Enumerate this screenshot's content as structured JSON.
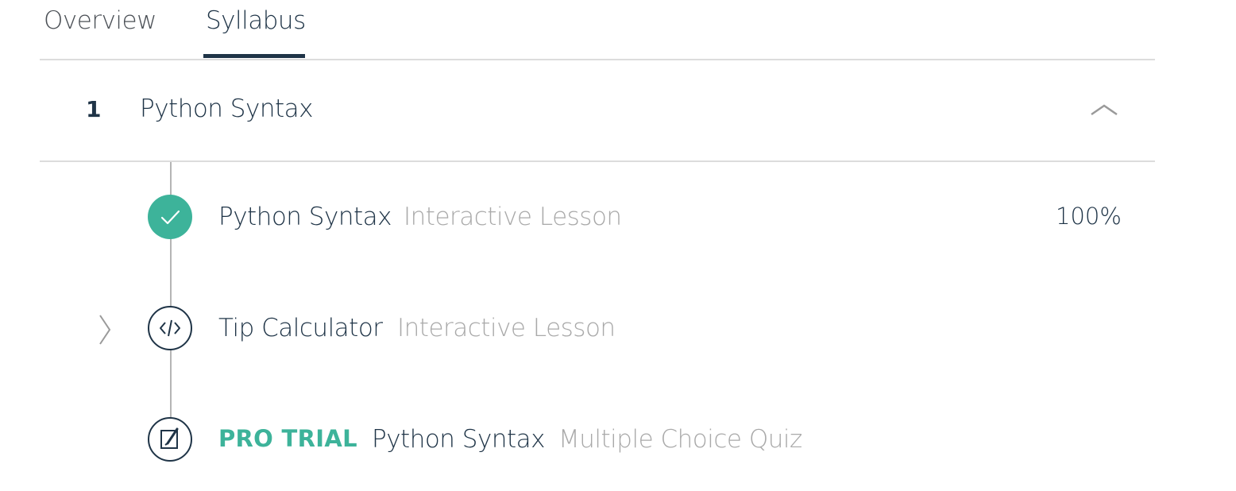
{
  "tabs": [
    {
      "label": "Overview",
      "active": false
    },
    {
      "label": "Syllabus",
      "active": true
    }
  ],
  "module": {
    "number": "1",
    "title": "Python Syntax",
    "expanded": true
  },
  "lessons": [
    {
      "title": "Python Syntax",
      "type": "Interactive Lesson",
      "progress": "100%",
      "status": "completed",
      "icon": "check-icon"
    },
    {
      "title": "Tip Calculator",
      "type": "Interactive Lesson",
      "status": "current",
      "icon": "code-icon"
    },
    {
      "badge": "PRO TRIAL",
      "title": "Python Syntax",
      "type": "Multiple Choice Quiz",
      "status": "locked",
      "icon": "quiz-pencil-icon"
    }
  ],
  "colors": {
    "accent": "#3db39a",
    "text_primary": "#1f3447",
    "text_muted": "#a9a9a9",
    "divider": "#dcdcdc"
  }
}
